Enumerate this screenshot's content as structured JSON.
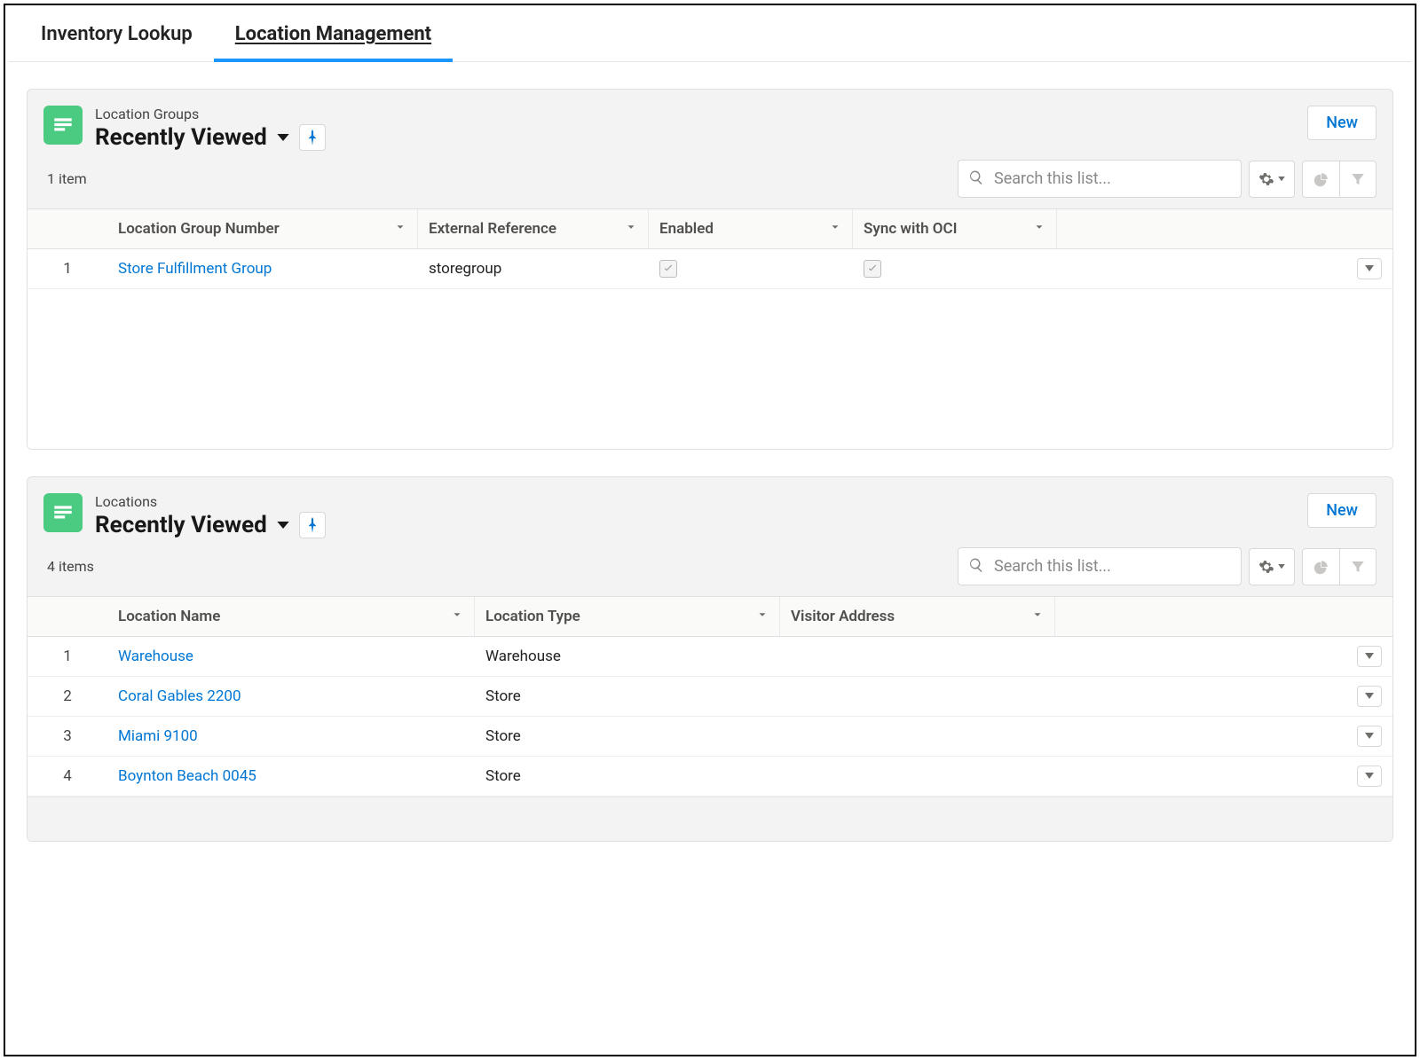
{
  "tabs": {
    "inactive": "Inventory Lookup",
    "active": "Location Management"
  },
  "location_groups": {
    "subtitle": "Location Groups",
    "view_title": "Recently Viewed",
    "item_count": "1 item",
    "search_placeholder": "Search this list...",
    "new_label": "New",
    "columns": {
      "number": "Location Group Number",
      "ext_ref": "External Reference",
      "enabled": "Enabled",
      "sync": "Sync with OCI"
    },
    "rows": [
      {
        "idx": "1",
        "number": "Store Fulfillment Group",
        "ext_ref": "storegroup",
        "enabled": true,
        "sync": true
      }
    ]
  },
  "locations": {
    "subtitle": "Locations",
    "view_title": "Recently Viewed",
    "item_count": "4 items",
    "search_placeholder": "Search this list...",
    "new_label": "New",
    "columns": {
      "name": "Location Name",
      "type": "Location Type",
      "address": "Visitor Address"
    },
    "rows": [
      {
        "idx": "1",
        "name": "Warehouse",
        "type": "Warehouse",
        "address": ""
      },
      {
        "idx": "2",
        "name": "Coral Gables 2200",
        "type": "Store",
        "address": ""
      },
      {
        "idx": "3",
        "name": "Miami 9100",
        "type": "Store",
        "address": ""
      },
      {
        "idx": "4",
        "name": "Boynton Beach 0045",
        "type": "Store",
        "address": ""
      }
    ]
  }
}
